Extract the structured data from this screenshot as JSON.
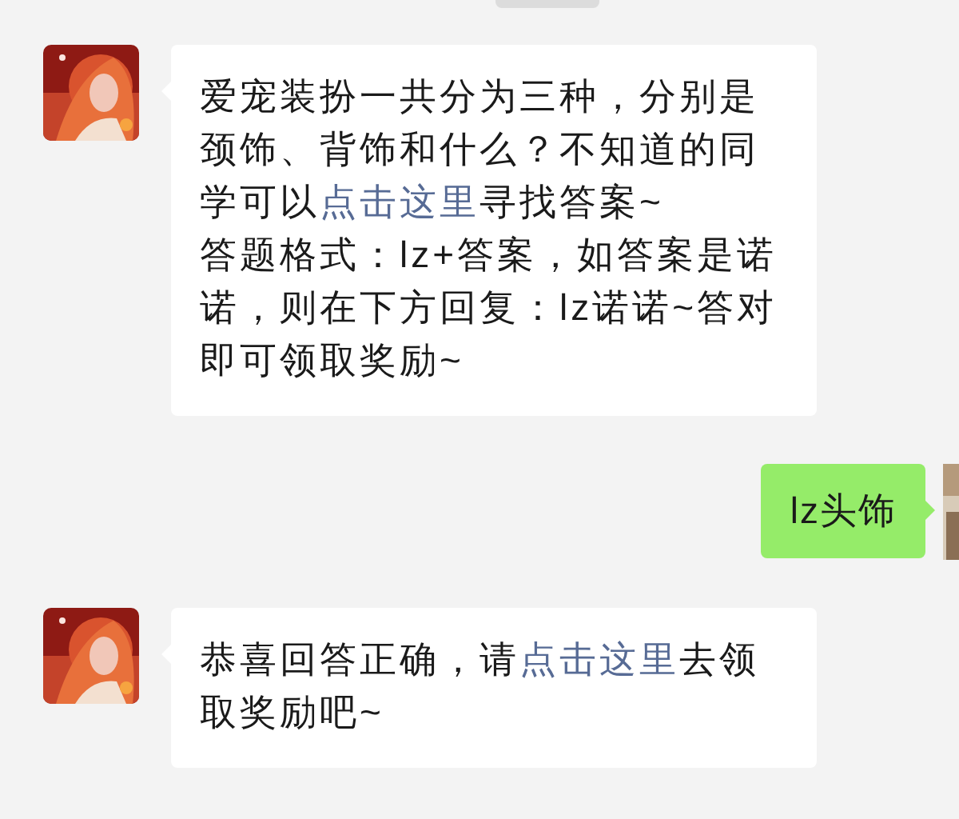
{
  "messages": [
    {
      "kind": "incoming",
      "paragraphs": [
        [
          {
            "kind": "text",
            "text": "爱宠装扮一共分为三种，分别是颈饰、背饰和什么？不知道的同学可以"
          },
          {
            "kind": "link",
            "text": "点击这里"
          },
          {
            "kind": "text",
            "text": "寻找答案~"
          }
        ],
        [
          {
            "kind": "text",
            "text": "答题格式：lz+答案，如答案是诺诺，则在下方回复：lz诺诺~答对即可领取奖励~"
          }
        ]
      ]
    },
    {
      "kind": "outgoing",
      "paragraphs": [
        [
          {
            "kind": "text",
            "text": "lz头饰"
          }
        ]
      ]
    },
    {
      "kind": "incoming",
      "paragraphs": [
        [
          {
            "kind": "text",
            "text": "恭喜回答正确，请"
          },
          {
            "kind": "link",
            "text": "点击这里"
          },
          {
            "kind": "text",
            "text": "去领取奖励吧~"
          }
        ]
      ]
    }
  ]
}
